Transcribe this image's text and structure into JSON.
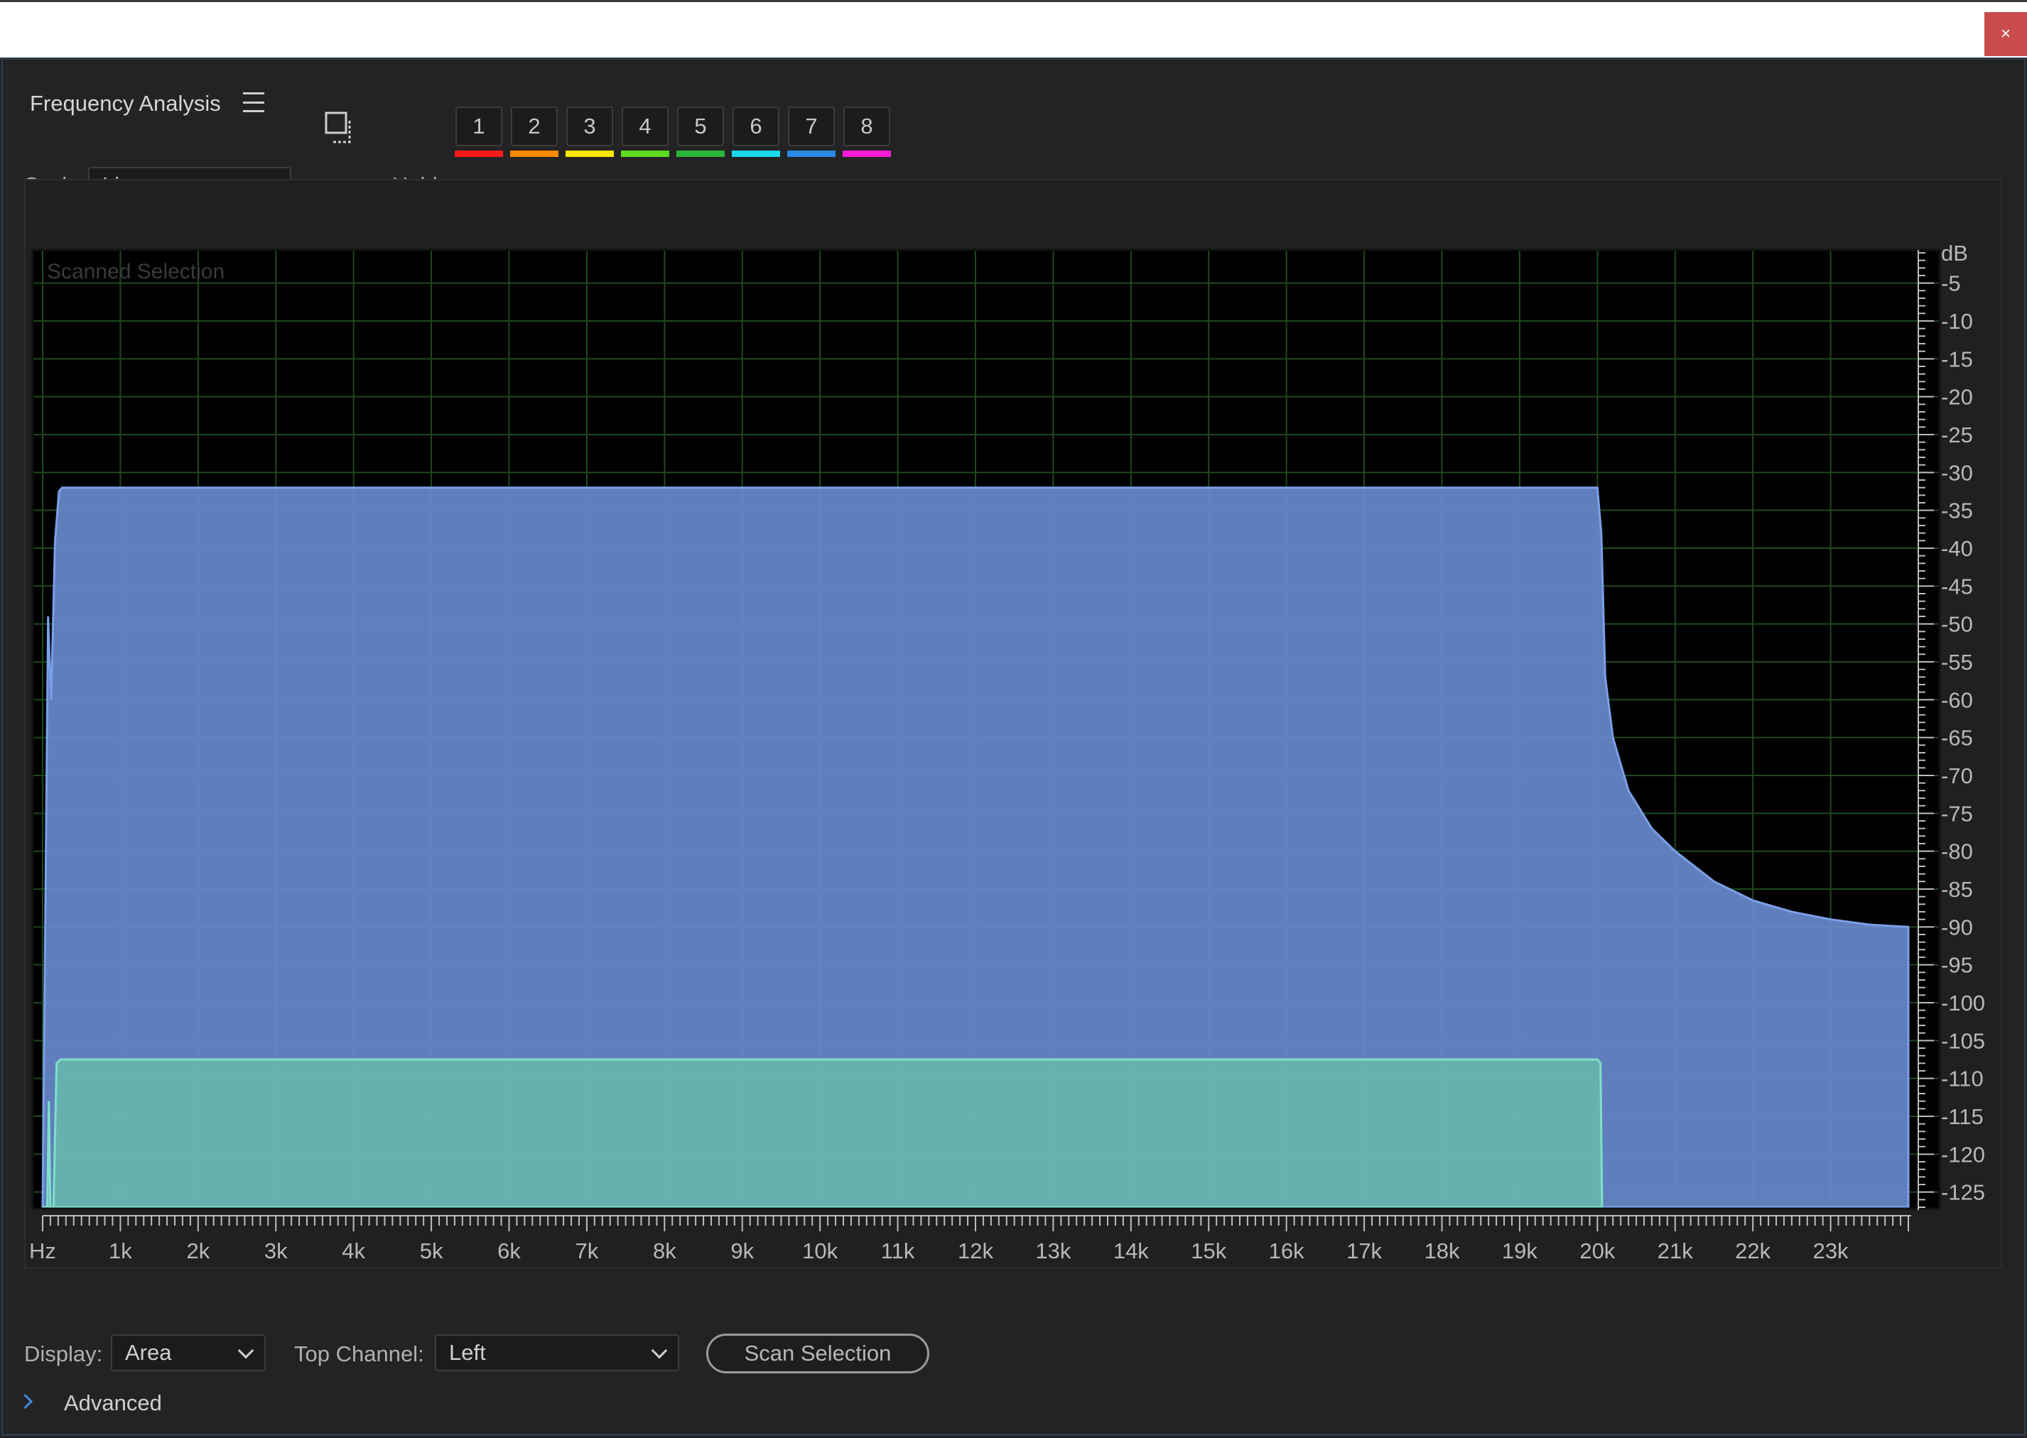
{
  "window": {
    "close_glyph": "×"
  },
  "panel": {
    "title": "Frequency Analysis",
    "menu_icon": "hamburger-icon"
  },
  "toolbar": {
    "scale_label": "Scale:",
    "scale_value": "Linear",
    "hold_label": "Hold:",
    "hold_buttons": [
      {
        "label": "1",
        "color": "#ff1a1a"
      },
      {
        "label": "2",
        "color": "#ff8a00"
      },
      {
        "label": "3",
        "color": "#ffe600"
      },
      {
        "label": "4",
        "color": "#5cdc1e"
      },
      {
        "label": "5",
        "color": "#2cb63a"
      },
      {
        "label": "6",
        "color": "#1ad8ee"
      },
      {
        "label": "7",
        "color": "#2a8ae8"
      },
      {
        "label": "8",
        "color": "#ff1ad8"
      }
    ]
  },
  "chart_data": {
    "type": "area",
    "overlay_label": "Scanned Selection",
    "xlabel_unit": "Hz",
    "ylabel_unit": "dB",
    "xlim": [
      0,
      24000
    ],
    "ylim": [
      -127,
      -1
    ],
    "x_ticks": [
      "Hz",
      "1k",
      "2k",
      "3k",
      "4k",
      "5k",
      "6k",
      "7k",
      "8k",
      "9k",
      "10k",
      "11k",
      "12k",
      "13k",
      "14k",
      "15k",
      "16k",
      "17k",
      "18k",
      "19k",
      "20k",
      "21k",
      "22k",
      "23k"
    ],
    "y_ticks": [
      "dB",
      "-5",
      "-10",
      "-15",
      "-20",
      "-25",
      "-30",
      "-35",
      "-40",
      "-45",
      "-50",
      "-55",
      "-60",
      "-65",
      "-70",
      "-75",
      "-80",
      "-85",
      "-90",
      "-95",
      "-100",
      "-105",
      "-110",
      "-115",
      "-120",
      "-125"
    ],
    "grid": true,
    "series": [
      {
        "color": "#6889cc",
        "x": [
          0,
          70,
          90,
          110,
          160,
          210,
          250,
          20000,
          20050,
          20100,
          20200,
          20400,
          20700,
          21000,
          21500,
          22000,
          22500,
          23000,
          23500,
          24000
        ],
        "y": [
          -127,
          -49,
          -55,
          -60,
          -39,
          -32.5,
          -32,
          -32,
          -38,
          -57,
          -65,
          -72,
          -77,
          -80,
          -84,
          -86.5,
          -88,
          -89,
          -89.7,
          -90
        ]
      },
      {
        "color": "#66b4ad",
        "x": [
          0,
          60,
          80,
          100,
          140,
          180,
          230,
          20000,
          20040,
          20060
        ],
        "y": [
          -127,
          -127,
          -113,
          -127,
          -127,
          -108,
          -107.5,
          -107.5,
          -108,
          -127
        ]
      }
    ]
  },
  "bottom": {
    "display_label": "Display:",
    "display_value": "Area",
    "top_channel_label": "Top Channel:",
    "top_channel_value": "Left",
    "scan_button": "Scan Selection",
    "advanced_label": "Advanced"
  }
}
